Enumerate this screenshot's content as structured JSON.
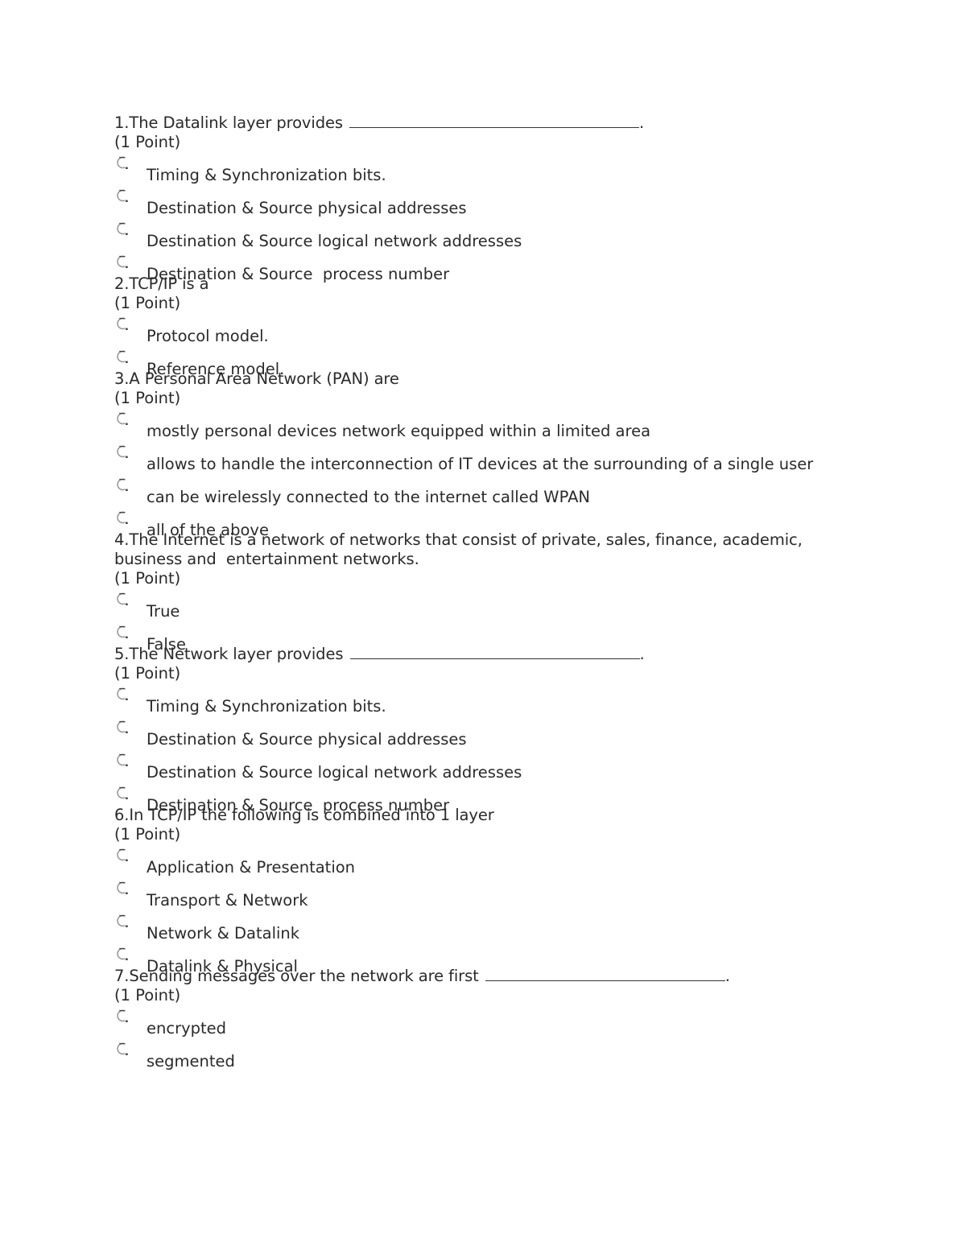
{
  "document": {
    "questions": [
      {
        "number": "1",
        "text_before_blank": "1.The Datalink layer provides ",
        "has_blank": true,
        "text_after_blank": ".",
        "points": "(1 Point)",
        "options": [
          "Timing & Synchronization bits.",
          "Destination & Source physical addresses",
          "Destination & Source logical network addresses",
          "Destination & Source  process number"
        ]
      },
      {
        "number": "2",
        "text_before_blank": "2.TCP/IP is a",
        "has_blank": false,
        "text_after_blank": "",
        "points": "(1 Point)",
        "options": [
          "Protocol model.",
          "Reference model."
        ]
      },
      {
        "number": "3",
        "text_before_blank": "3.A Personal Area Network (PAN) are",
        "has_blank": false,
        "text_after_blank": "",
        "points": "(1 Point)",
        "options": [
          "mostly personal devices network equipped within a limited area",
          "allows to handle the interconnection of IT devices at the surrounding of a single user",
          "can be wirelessly connected to the internet called WPAN",
          "all of the above"
        ]
      },
      {
        "number": "4",
        "text_before_blank": "4.The Internet is a network of networks that consist of private, sales, finance, academic, business and  entertainment networks.",
        "has_blank": false,
        "text_after_blank": "",
        "points": "(1 Point)",
        "options": [
          "True",
          "False"
        ]
      },
      {
        "number": "5",
        "text_before_blank": "5.The Network layer provides ",
        "has_blank": true,
        "text_after_blank": ".",
        "points": "(1 Point)",
        "options": [
          "Timing & Synchronization bits.",
          "Destination & Source physical addresses",
          "Destination & Source logical network addresses",
          "Destination & Source  process number"
        ]
      },
      {
        "number": "6",
        "text_before_blank": "6.In TCP/IP the following is combined into 1 layer",
        "has_blank": false,
        "text_after_blank": "",
        "points": "(1 Point)",
        "options": [
          "Application & Presentation",
          "Transport & Network",
          "Network & Datalink",
          "Datalink & Physical"
        ]
      },
      {
        "number": "7",
        "text_before_blank": "7.Sending messages over the network are first ",
        "has_blank": true,
        "text_after_blank": ".",
        "points": "(1 Point)",
        "options": [
          "encrypted",
          "segmented"
        ]
      }
    ],
    "option_icon": "radio-button-icon"
  }
}
